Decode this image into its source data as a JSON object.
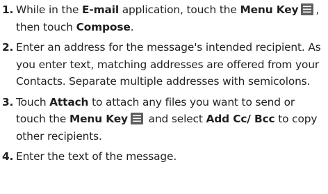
{
  "steps": [
    {
      "number": "1.",
      "parts": {
        "a": "While in the ",
        "b": "E-mail",
        "c": " application, touch the ",
        "d": "Menu Key",
        "e": ", then touch ",
        "f": "Compose",
        "g": "."
      },
      "icon": "menu-key-icon"
    },
    {
      "number": "2.",
      "text": "Enter an address for the message's intended recipient. As you enter text, matching addresses are offered from your Contacts. Separate multiple addresses with semicolons."
    },
    {
      "number": "3.",
      "parts": {
        "a": "Touch ",
        "b": "Attach",
        "c": " to attach any files you want to send or touch the ",
        "d": "Menu Key",
        "e": " and select ",
        "f": "Add Cc/ Bcc",
        "g": " to copy other recipients."
      },
      "icon": "menu-key-icon"
    },
    {
      "number": "4.",
      "text": "Enter the text of the message."
    }
  ],
  "colors": {
    "text": "#231f20",
    "icon": "#5e5e5e"
  }
}
